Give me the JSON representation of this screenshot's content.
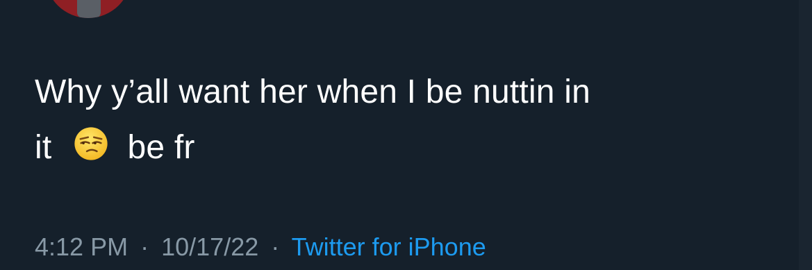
{
  "tweet": {
    "text_line1": "Why y’all want her when I be nuttin in",
    "text_line2_before": "it",
    "text_line2_after": "be fr",
    "emoji_name": "unamused-face-emoji"
  },
  "meta": {
    "time": "4:12 PM",
    "separator": "·",
    "date": "10/17/22",
    "source": "Twitter for iPhone"
  },
  "colors": {
    "background": "#15202b",
    "text": "#ffffff",
    "meta": "#8899a6",
    "link": "#1d9bf0"
  }
}
